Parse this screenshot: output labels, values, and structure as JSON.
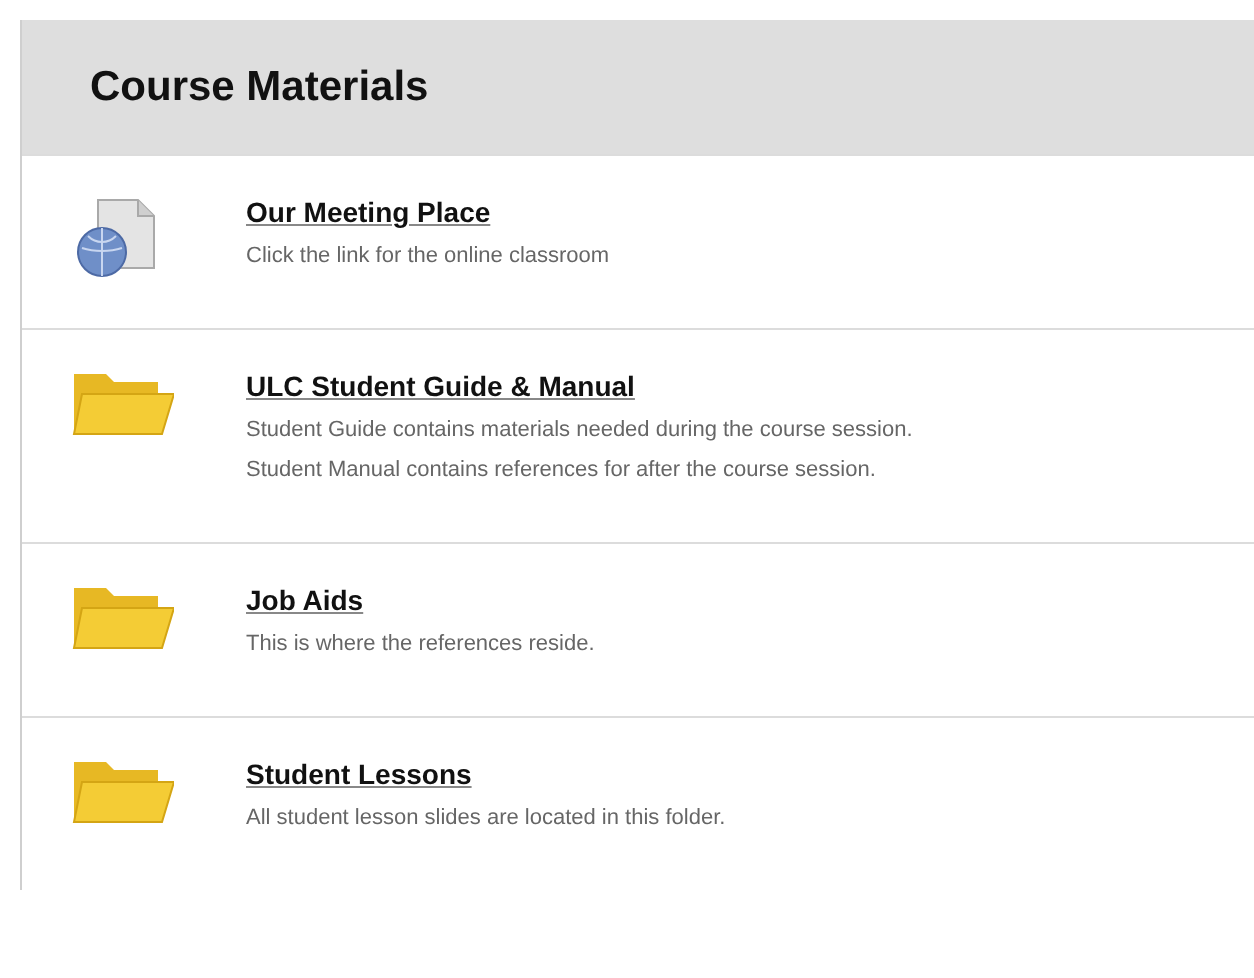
{
  "title": "Course Materials",
  "items": [
    {
      "kind": "link",
      "title": "Our Meeting Place",
      "description": [
        "Click the link for the online classroom"
      ]
    },
    {
      "kind": "folder",
      "title": "ULC Student Guide & Manual",
      "description": [
        "Student Guide contains materials needed during the course session.",
        "Student Manual contains references for after the course session."
      ]
    },
    {
      "kind": "folder",
      "title": "Job Aids",
      "description": [
        "This is where the references reside."
      ]
    },
    {
      "kind": "folder",
      "title": "Student Lessons",
      "description": [
        "All student lesson slides are located in this folder."
      ]
    }
  ]
}
